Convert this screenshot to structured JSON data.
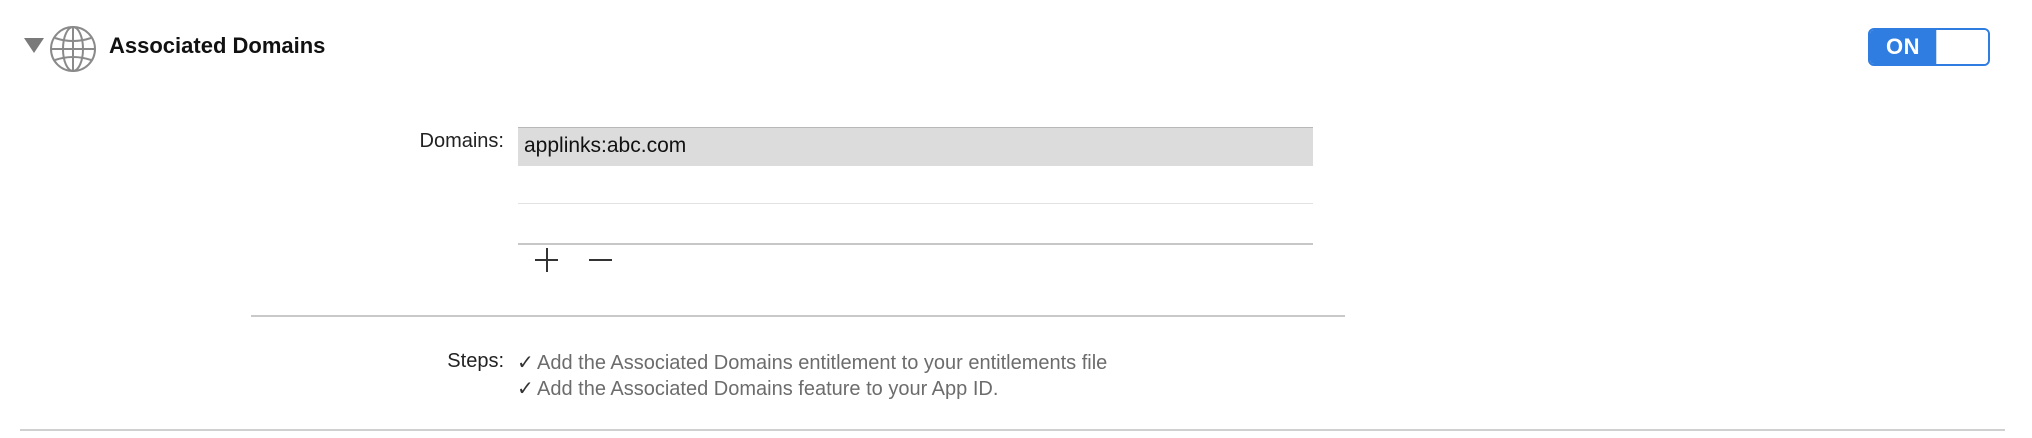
{
  "section": {
    "title": "Associated Domains",
    "icon": "globe-icon",
    "expanded": true
  },
  "toggle": {
    "label": "ON",
    "state": "on",
    "accent_color": "#2f7de1"
  },
  "domains": {
    "label": "Domains:",
    "items": [
      "applinks:abc.com"
    ],
    "selected_index": 0,
    "add_icon": "plus-icon",
    "remove_icon": "minus-icon"
  },
  "steps": {
    "label": "Steps:",
    "items": [
      "Add the Associated Domains entitlement to your entitlements file",
      "Add the Associated Domains feature to your App ID."
    ],
    "check_glyph": "✓"
  }
}
